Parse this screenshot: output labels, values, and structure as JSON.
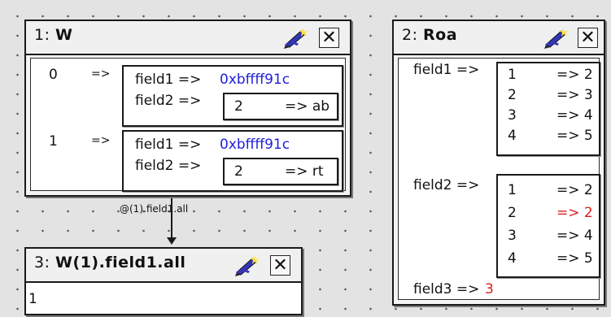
{
  "panels": {
    "w": {
      "number": "1:",
      "name": "W",
      "rows": [
        {
          "index": "0",
          "arrow": "=>",
          "field1_label": "field1 =>",
          "field1_value": "0xbffff91c",
          "field2_label": "field2 =>",
          "field2_index": "2",
          "field2_arrow_value": "=> ab"
        },
        {
          "index": "1",
          "arrow": "=>",
          "field1_label": "field1 =>",
          "field1_value": "0xbffff91c",
          "field2_label": "field2 =>",
          "field2_index": "2",
          "field2_arrow_value": "=> rt"
        }
      ]
    },
    "roa": {
      "number": "2:",
      "name": "Roa",
      "field1_label": "field1 =>",
      "field1_items": [
        {
          "index": "1",
          "value": "=> 2"
        },
        {
          "index": "2",
          "value": "=> 3"
        },
        {
          "index": "3",
          "value": "=> 4"
        },
        {
          "index": "4",
          "value": "=> 5"
        }
      ],
      "field2_label": "field2 =>",
      "field2_items": [
        {
          "index": "1",
          "value": "=> 2"
        },
        {
          "index": "2",
          "value": "=> 2"
        },
        {
          "index": "3",
          "value": "=> 4"
        },
        {
          "index": "4",
          "value": "=> 5"
        }
      ],
      "field3_label": "field3 =>",
      "field3_value": "3"
    },
    "w1": {
      "number": "3:",
      "name": "W(1).field1.all",
      "value": "1"
    }
  },
  "link_label": "@(1).field1.all",
  "icons": {
    "edit": "edit-pen-icon",
    "close": "close-icon",
    "close_glyph": "✕"
  },
  "colors": {
    "changed_value": "#d81e1e",
    "address_value": "#2020d8",
    "canvas": "#e3e3e3"
  }
}
